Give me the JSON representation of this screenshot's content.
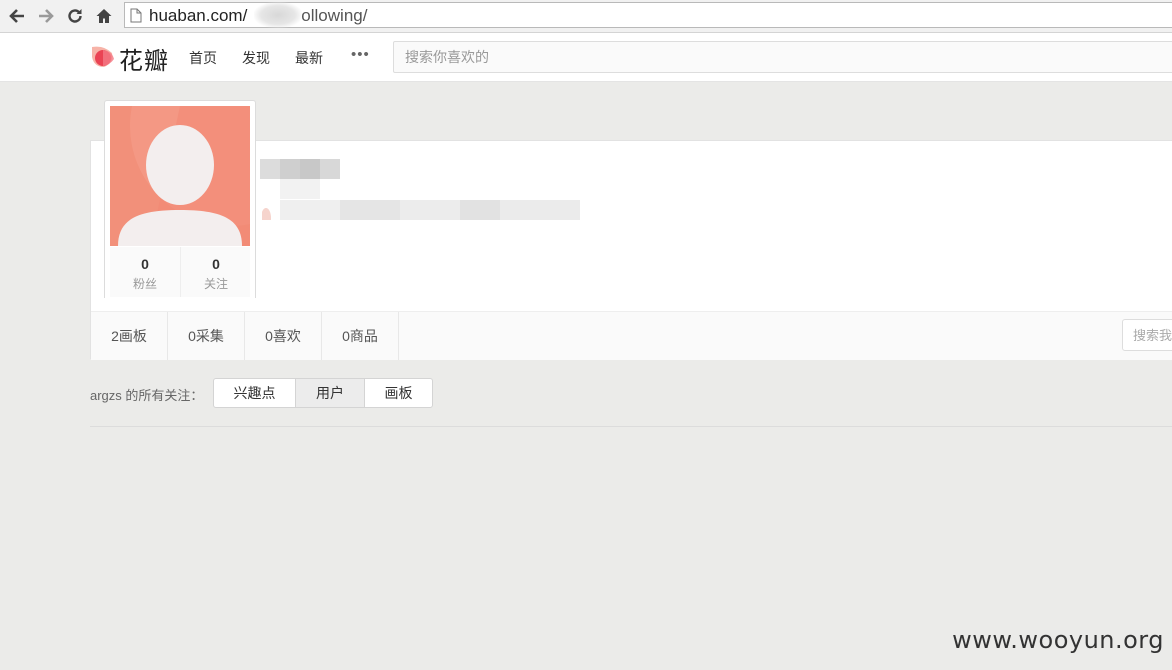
{
  "browser": {
    "url_host": "huaban.com/",
    "url_path": "ollowing/"
  },
  "header": {
    "logo_text": "花瓣",
    "nav": [
      "首页",
      "发现",
      "最新"
    ],
    "more": "•••",
    "search_placeholder": "搜索你喜欢的"
  },
  "profile": {
    "stats": [
      {
        "value": "0",
        "label": "粉丝"
      },
      {
        "value": "0",
        "label": "关注"
      }
    ],
    "tabs": [
      "2画板",
      "0采集",
      "0喜欢",
      "0商品"
    ],
    "search_placeholder": "搜索我"
  },
  "following": {
    "label": "argzs 的所有关注：",
    "filters": [
      "兴趣点",
      "用户",
      "画板"
    ],
    "active_index": 1
  },
  "watermark": "www.wooyun.org",
  "colors": {
    "accent": "#f2907a",
    "logo_red": "#e8364a"
  }
}
